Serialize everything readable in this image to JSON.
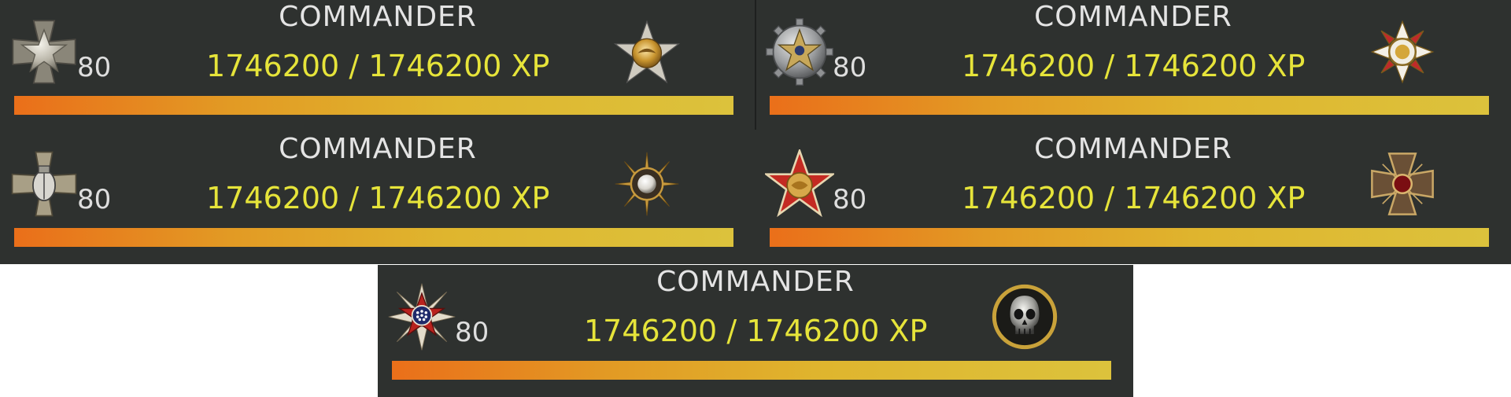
{
  "panels": [
    {
      "rank_title": "COMMANDER",
      "level": "80",
      "xp_text": "1746200 / 1746200 XP",
      "xp_progress": 1.0,
      "rank_icon": "silver-cross-star-icon",
      "prestige_icon": "gold-eagle-star-icon"
    },
    {
      "rank_title": "COMMANDER",
      "level": "80",
      "xp_text": "1746200 / 1746200 XP",
      "xp_progress": 1.0,
      "rank_icon": "gear-star-icon",
      "prestige_icon": "red-white-cross-medal-icon"
    },
    {
      "rank_title": "COMMANDER",
      "level": "80",
      "xp_text": "1746200 / 1746200 XP",
      "xp_progress": 1.0,
      "rank_icon": "cross-bomb-icon",
      "prestige_icon": "pearl-sunburst-medal-icon"
    },
    {
      "rank_title": "COMMANDER",
      "level": "80",
      "xp_text": "1746200 / 1746200 XP",
      "xp_progress": 1.0,
      "rank_icon": "red-star-globe-icon",
      "prestige_icon": "iron-cross-medal-icon"
    },
    {
      "rank_title": "COMMANDER",
      "level": "80",
      "xp_text": "1746200 / 1746200 XP",
      "xp_progress": 1.0,
      "rank_icon": "star-order-medal-icon",
      "prestige_icon": "gold-skull-icon"
    }
  ],
  "colors": {
    "panel_bg": "#2e312f",
    "xp_text": "#e6e43a",
    "title_text": "#e4e4e4",
    "bar_start": "#ea6f1a",
    "bar_end": "#dcc23c"
  }
}
